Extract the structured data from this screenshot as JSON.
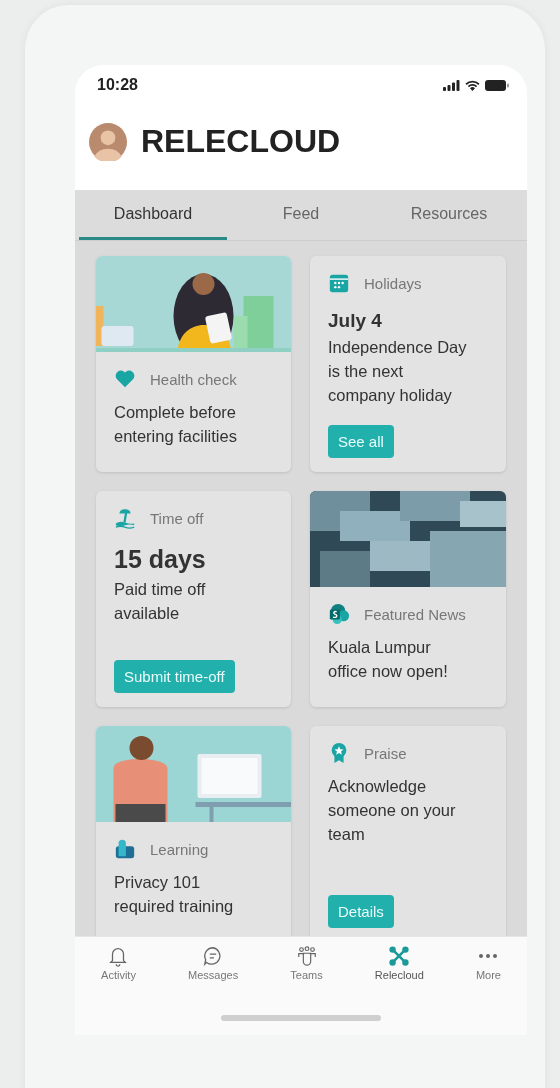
{
  "status_bar": {
    "time": "10:28"
  },
  "header": {
    "title": "RELECLOUD"
  },
  "tabs": [
    {
      "label": "Dashboard",
      "selected": true
    },
    {
      "label": "Feed",
      "selected": false
    },
    {
      "label": "Resources",
      "selected": false
    }
  ],
  "cards": [
    {
      "kind": "health",
      "picture": true,
      "label": "Health check",
      "body": "Complete before entering facilities"
    },
    {
      "kind": "holidays",
      "picture": false,
      "label": "Holidays",
      "headline": "July 4",
      "body": "Independence Day is the next company holiday",
      "button": "See all"
    },
    {
      "kind": "timeoff",
      "picture": false,
      "label": "Time off",
      "headline": "15 days",
      "body": "Paid time off available",
      "button": "Submit time-off"
    },
    {
      "kind": "news",
      "picture": true,
      "label": "Featured News",
      "body": "Kuala Lumpur office now open!"
    },
    {
      "kind": "learning",
      "picture": true,
      "label": "Learning",
      "body": "Privacy 101 required training"
    },
    {
      "kind": "praise",
      "picture": false,
      "label": "Praise",
      "body": "Acknowledge someone on your team",
      "button": "Details"
    }
  ],
  "nav": [
    {
      "kind": "activity",
      "label": "Activity",
      "selected": false
    },
    {
      "kind": "messages",
      "label": "Messages",
      "selected": false
    },
    {
      "kind": "teams",
      "label": "Teams",
      "selected": false
    },
    {
      "kind": "relecloud",
      "label": "Relecloud",
      "selected": true
    },
    {
      "kind": "more",
      "label": "More",
      "selected": false
    }
  ]
}
